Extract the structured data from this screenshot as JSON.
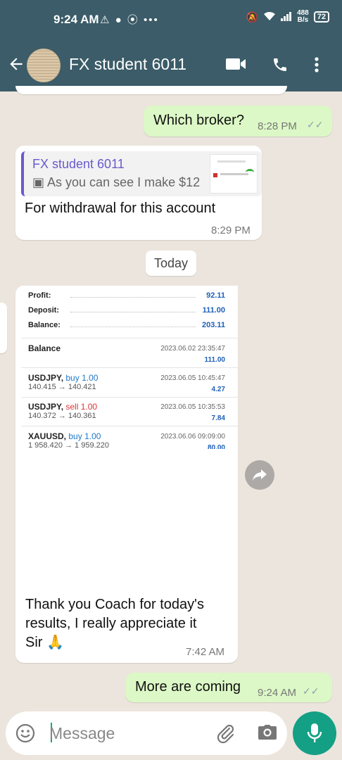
{
  "status_bar": {
    "time": "9:24 AM",
    "net_speed_value": "488",
    "net_speed_unit": "B/s",
    "battery": "72"
  },
  "header": {
    "contact_name": "FX student 6011",
    "icons": [
      "back-arrow-icon",
      "avatar",
      "video-call-icon",
      "phone-icon",
      "more-vert-icon"
    ]
  },
  "messages": {
    "m1": {
      "text": "Which broker?",
      "time": "8:28 PM"
    },
    "m2": {
      "quote_name": "FX student 6011",
      "quote_text": "As you can see I make $12",
      "text": "For withdrawal for this account",
      "time": "8:29 PM"
    },
    "date_chip": "Today",
    "m3": {
      "summary": [
        {
          "label": "Profit:",
          "value": "92.11"
        },
        {
          "label": "Deposit:",
          "value": "111.00"
        },
        {
          "label": "Balance:",
          "value": "203.11"
        }
      ],
      "entries": [
        {
          "symbol": "Balance",
          "side": "",
          "qty": "",
          "prices": "",
          "date": "2023.06.02 23:35:47",
          "amount": "111.00"
        },
        {
          "symbol": "USDJPY,",
          "side": "buy",
          "qty": "1.00",
          "prices": "140.415 → 140.421",
          "date": "2023.06.05 10:45:47",
          "amount": "4.27"
        },
        {
          "symbol": "USDJPY,",
          "side": "sell",
          "qty": "1.00",
          "prices": "140.372 → 140.361",
          "date": "2023.06.05 10:35:53",
          "amount": "7.84"
        },
        {
          "symbol": "XAUUSD,",
          "side": "buy",
          "qty": "1.00",
          "prices": "1 958.420 → 1 959.220",
          "date": "2023.06.06 09:09:00",
          "amount": "80.00"
        }
      ],
      "text_line1": "Thank you Coach for today's",
      "text_line2": "results, I really appreciate it",
      "text_line3": "Sir",
      "emoji": "🙏",
      "time": "7:42 AM"
    },
    "m4": {
      "text": "More are coming",
      "time": "9:24 AM"
    }
  },
  "composer": {
    "placeholder": "Message",
    "icons": [
      "emoji-icon",
      "attach-icon",
      "camera-icon",
      "mic-icon"
    ]
  },
  "colors": {
    "header": "#3b5c68",
    "outgoing_bubble": "#dcf8c6",
    "incoming_bubble": "#ffffff",
    "accent": "#14a085"
  }
}
